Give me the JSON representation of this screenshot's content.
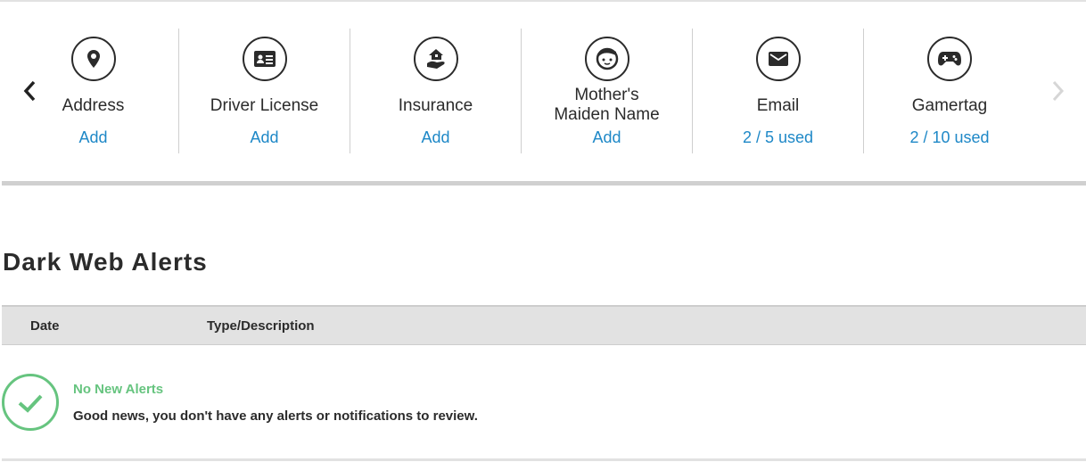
{
  "carousel": {
    "items": [
      {
        "label": "Address",
        "action": "Add",
        "icon": "location-pin-icon"
      },
      {
        "label": "Driver License",
        "action": "Add",
        "icon": "id-card-icon"
      },
      {
        "label": "Insurance",
        "action": "Add",
        "icon": "insurance-hand-house-icon"
      },
      {
        "label": "Mother's",
        "label2": "Maiden Name",
        "action": "Add",
        "icon": "face-icon"
      },
      {
        "label": "Email",
        "action": "2 / 5 used",
        "icon": "envelope-icon"
      },
      {
        "label": "Gamertag",
        "action": "2 / 10 used",
        "icon": "gamepad-icon"
      }
    ]
  },
  "alerts": {
    "title": "Dark Web Alerts",
    "columns": [
      "Date",
      "Type/Description"
    ],
    "empty_title": "No New Alerts",
    "empty_message": "Good news, you don't have any alerts or notifications to review."
  },
  "colors": {
    "link": "#1e88c7",
    "success": "#66c47f"
  }
}
